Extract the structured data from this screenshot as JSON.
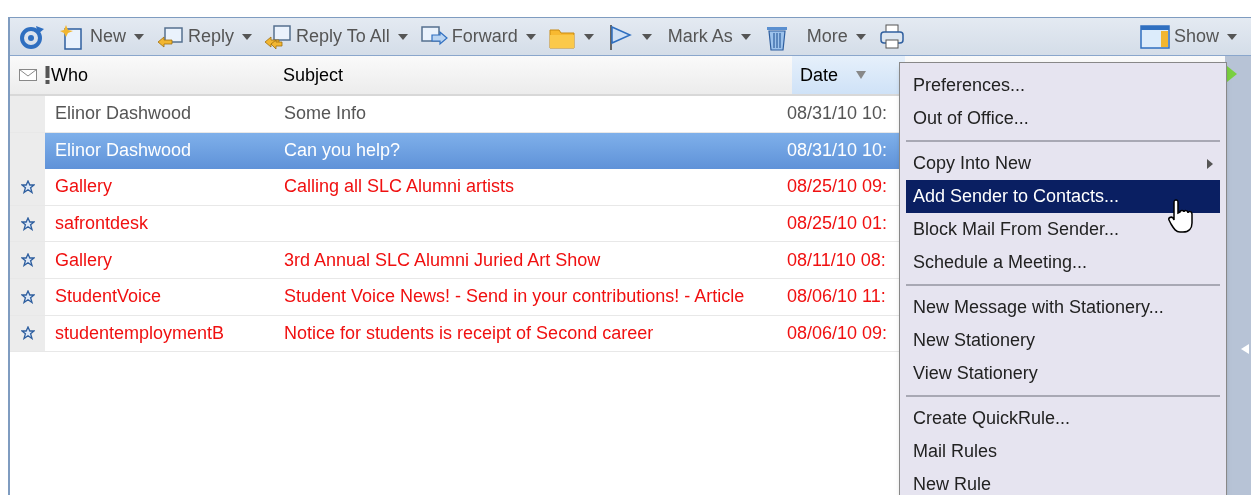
{
  "toolbar": {
    "items": [
      {
        "dropdown": false
      },
      {
        "label": "New",
        "dropdown": true
      },
      {
        "label": "Reply",
        "dropdown": true
      },
      {
        "label": "Reply To All",
        "dropdown": true
      },
      {
        "label": "Forward",
        "dropdown": true
      },
      {
        "dropdown": true
      },
      {
        "dropdown": true
      },
      {
        "label": "Mark As",
        "dropdown": true
      },
      {
        "dropdown": false
      },
      {
        "label": "More",
        "dropdown": true
      },
      {
        "dropdown": false
      }
    ],
    "show": {
      "label": "Show",
      "dropdown": true
    }
  },
  "table": {
    "columns": [
      {
        "label": "Who",
        "sorted": false
      },
      {
        "label": "Subject",
        "sorted": false
      },
      {
        "label": "Date",
        "sorted": true
      }
    ],
    "rows": [
      {
        "who": "Elinor Dashwood",
        "subject": "Some Info",
        "date": "08/31/10 10:",
        "selected": false,
        "unread": false,
        "starred": false
      },
      {
        "who": "Elinor Dashwood",
        "subject": "Can you help?",
        "date": "08/31/10 10:",
        "selected": true,
        "unread": false,
        "starred": false
      },
      {
        "who": "Gallery",
        "subject": "Calling all SLC Alumni artists",
        "date": "08/25/10 09:",
        "selected": false,
        "unread": true,
        "starred": true
      },
      {
        "who": "safrontdesk",
        "date": "08/25/10 01:",
        "selected": false,
        "unread": true,
        "starred": true
      },
      {
        "who": "Gallery",
        "subject": "3rd Annual SLC Alumni Juried Art Show",
        "date": "08/11/10 08:",
        "selected": false,
        "unread": true,
        "starred": true
      },
      {
        "who": "StudentVoice",
        "subject": "Student Voice News! - Send in your contributions! - Article",
        "date": "08/06/10 11:",
        "selected": false,
        "unread": true,
        "starred": true
      },
      {
        "who": "studentemploymentB",
        "subject": "Notice for students is receipt of Second career",
        "date": "08/06/10 09:",
        "selected": false,
        "unread": true,
        "starred": true
      }
    ]
  },
  "context_menu": {
    "sections": [
      {
        "items": [
          {
            "label": "Preferences...",
            "selected": false,
            "submenu": false
          },
          {
            "label": "Out of Office...",
            "selected": false,
            "submenu": false
          }
        ]
      },
      {
        "items": [
          {
            "label": "Copy Into New",
            "selected": false,
            "submenu": true
          },
          {
            "label": "Add Sender to Contacts...",
            "selected": true,
            "submenu": false
          },
          {
            "label": "Block Mail From Sender...",
            "selected": false,
            "submenu": false
          },
          {
            "label": "Schedule a Meeting...",
            "selected": false,
            "submenu": false
          }
        ]
      },
      {
        "items": [
          {
            "label": "New Message with Stationery...",
            "selected": false,
            "submenu": false
          },
          {
            "label": "New Stationery",
            "selected": false,
            "submenu": false
          },
          {
            "label": "View Stationery",
            "selected": false,
            "submenu": false
          }
        ]
      },
      {
        "items": [
          {
            "label": "Create QuickRule...",
            "selected": false,
            "submenu": false
          },
          {
            "label": "Mail Rules",
            "selected": false,
            "submenu": false
          },
          {
            "label": "New Rule",
            "selected": false,
            "submenu": false
          }
        ]
      }
    ]
  }
}
